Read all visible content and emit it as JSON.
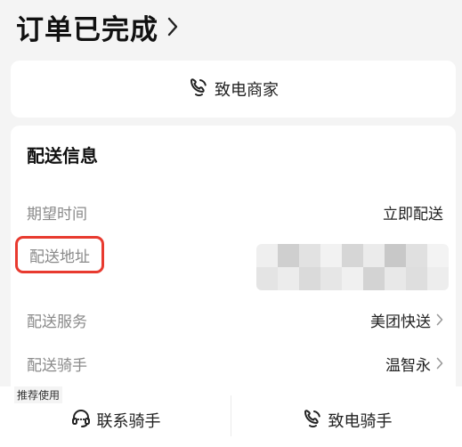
{
  "header": {
    "title": "订单已完成",
    "chevron_icon": "chevron-right-icon"
  },
  "merchant": {
    "call_label": "致电商家",
    "icon": "phone-icon"
  },
  "delivery": {
    "section_title": "配送信息",
    "rows": {
      "expected_time": {
        "label": "期望时间",
        "value": "立即配送"
      },
      "address": {
        "label": "配送地址",
        "value_icon": "redacted-mosaic"
      },
      "service": {
        "label": "配送服务",
        "value": "美团快送"
      },
      "rider": {
        "label": "配送骑手",
        "value": "温智永"
      }
    },
    "highlight_color": "#e83a2f"
  },
  "footer": {
    "recommend_badge": "推荐使用",
    "contact_rider_label": "联系骑手",
    "contact_rider_icon": "headset-icon",
    "call_rider_label": "致电骑手",
    "call_rider_icon": "phone-icon"
  }
}
